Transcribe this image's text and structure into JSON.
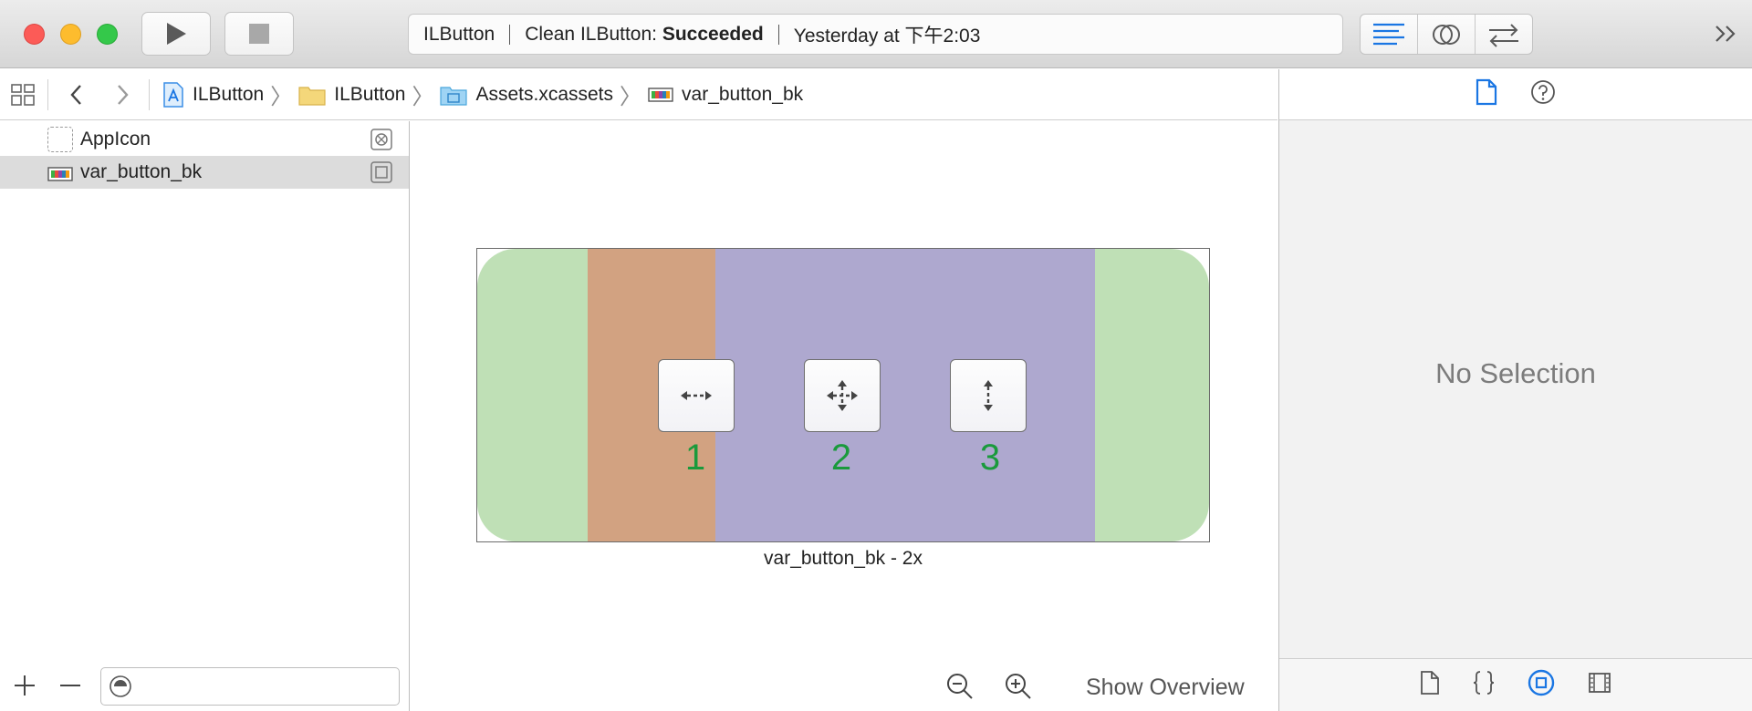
{
  "toolbar": {
    "activity": {
      "scheme": "ILButton",
      "status_prefix": "Clean ILButton:",
      "status_result": "Succeeded",
      "timestamp": "Yesterday at 下午2:03"
    }
  },
  "jumpbar": {
    "crumbs": [
      "ILButton",
      "ILButton",
      "Assets.xcassets",
      "var_button_bk"
    ]
  },
  "asset_list": {
    "items": [
      {
        "label": "AppIcon",
        "selected": false
      },
      {
        "label": "var_button_bk",
        "selected": true
      }
    ]
  },
  "editor": {
    "slice_numbers": [
      "1",
      "2",
      "3"
    ],
    "caption": "var_button_bk - 2x",
    "show_overview": "Show Overview"
  },
  "inspector": {
    "no_selection": "No Selection"
  },
  "colors": {
    "accent": "#1a76e3",
    "cap_green": "#bfe0b6",
    "stretch_orange": "#d2a281",
    "stretch_purple": "#aea8cf",
    "slice_number_green": "#1a9a3c"
  }
}
